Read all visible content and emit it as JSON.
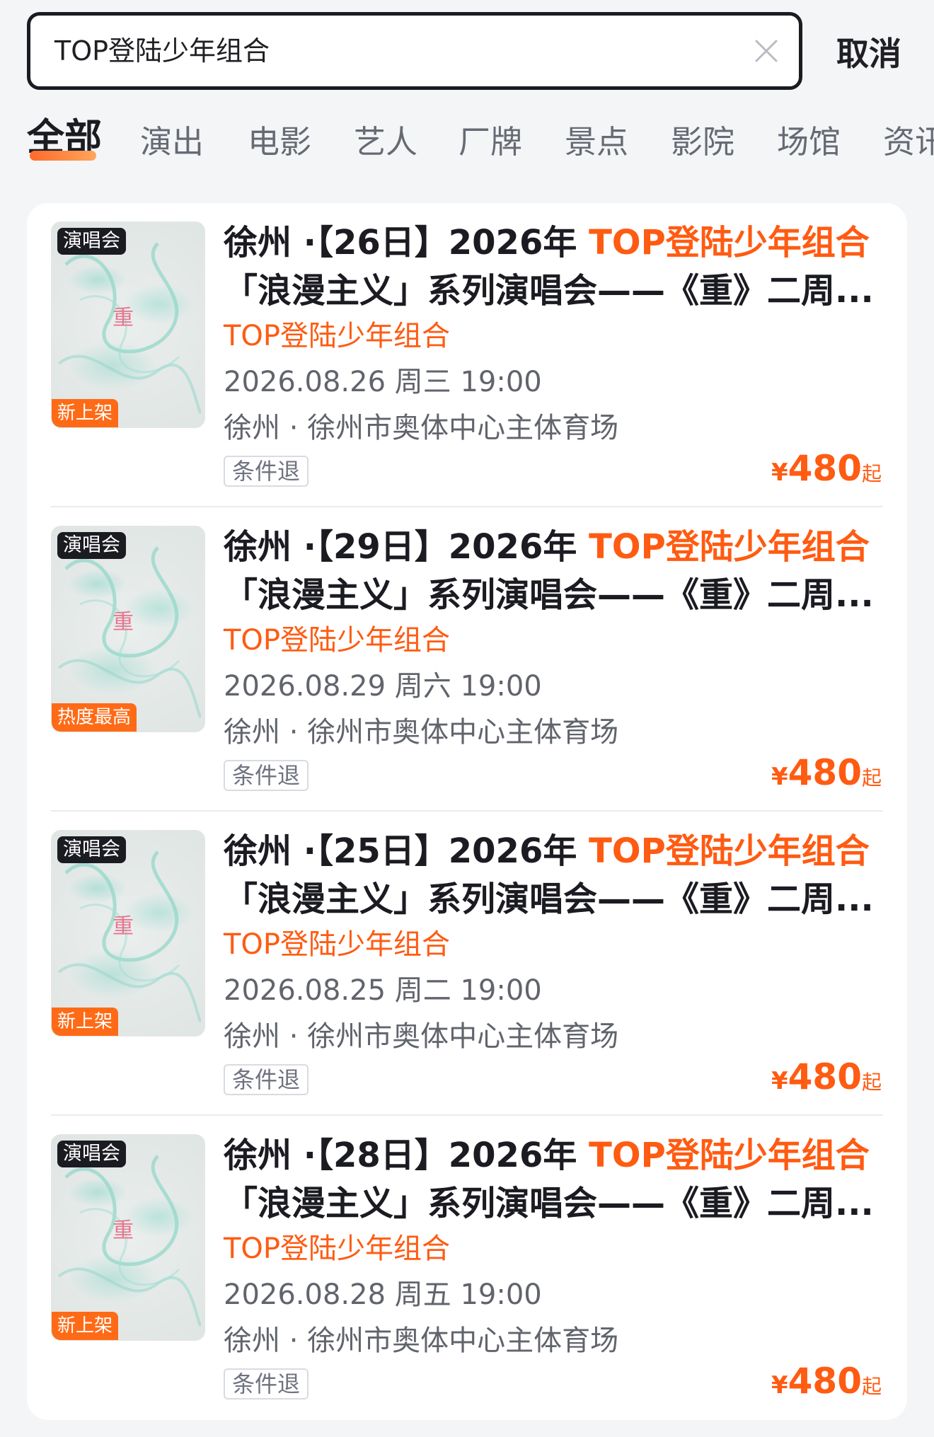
{
  "search": {
    "query": "TOP登陆少年组合",
    "cancel_label": "取消"
  },
  "tabs": [
    {
      "label": "全部",
      "active": true
    },
    {
      "label": "演出",
      "active": false
    },
    {
      "label": "电影",
      "active": false
    },
    {
      "label": "艺人",
      "active": false
    },
    {
      "label": "厂牌",
      "active": false
    },
    {
      "label": "景点",
      "active": false
    },
    {
      "label": "影院",
      "active": false
    },
    {
      "label": "场馆",
      "active": false
    },
    {
      "label": "资讯",
      "active": false
    }
  ],
  "colors": {
    "accent": "#ff5b12",
    "tag_orange": "#ff6a16",
    "dark": "#1b1b22"
  },
  "results": [
    {
      "badge_type": "演唱会",
      "badge_tag": "新上架",
      "poster_char": "重",
      "title_prefix": "徐州 ·【26日】2026年 ",
      "title_highlight": "TOP登陆少年组合",
      "title_line2": "「浪漫主义」系列演唱会——《重》二周...",
      "artist": "TOP登陆少年组合",
      "datetime": "2026.08.26 周三 19:00",
      "venue": "徐州 · 徐州市奥体中心主体育场",
      "refund": "条件退",
      "price_currency": "¥",
      "price_value": "480",
      "price_suffix": "起"
    },
    {
      "badge_type": "演唱会",
      "badge_tag": "热度最高",
      "poster_char": "重",
      "title_prefix": "徐州 ·【29日】2026年 ",
      "title_highlight": "TOP登陆少年组合",
      "title_line2": "「浪漫主义」系列演唱会——《重》二周...",
      "artist": "TOP登陆少年组合",
      "datetime": "2026.08.29 周六 19:00",
      "venue": "徐州 · 徐州市奥体中心主体育场",
      "refund": "条件退",
      "price_currency": "¥",
      "price_value": "480",
      "price_suffix": "起"
    },
    {
      "badge_type": "演唱会",
      "badge_tag": "新上架",
      "poster_char": "重",
      "title_prefix": "徐州 ·【25日】2026年 ",
      "title_highlight": "TOP登陆少年组合",
      "title_line2": "「浪漫主义」系列演唱会——《重》二周...",
      "artist": "TOP登陆少年组合",
      "datetime": "2026.08.25 周二 19:00",
      "venue": "徐州 · 徐州市奥体中心主体育场",
      "refund": "条件退",
      "price_currency": "¥",
      "price_value": "480",
      "price_suffix": "起"
    },
    {
      "badge_type": "演唱会",
      "badge_tag": "新上架",
      "poster_char": "重",
      "title_prefix": "徐州 ·【28日】2026年 ",
      "title_highlight": "TOP登陆少年组合",
      "title_line2": "「浪漫主义」系列演唱会——《重》二周...",
      "artist": "TOP登陆少年组合",
      "datetime": "2026.08.28 周五 19:00",
      "venue": "徐州 · 徐州市奥体中心主体育场",
      "refund": "条件退",
      "price_currency": "¥",
      "price_value": "480",
      "price_suffix": "起"
    }
  ]
}
